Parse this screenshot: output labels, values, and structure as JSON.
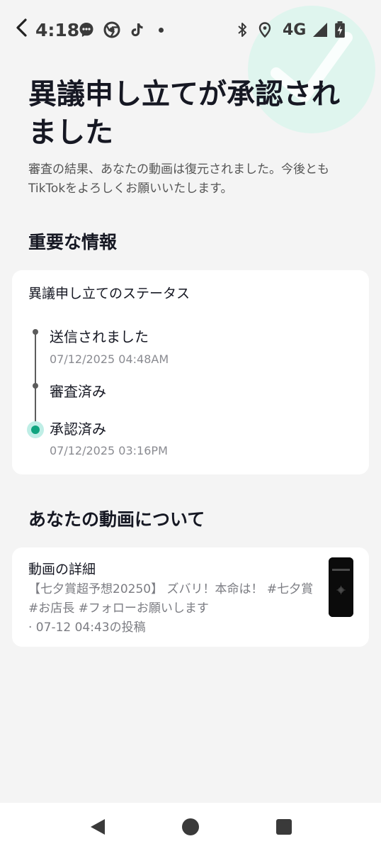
{
  "status_bar": {
    "time": "4:18",
    "network": "4G",
    "icons": [
      "messenger-icon",
      "chrome-icon",
      "tiktok-icon",
      "notification-dot",
      "bluetooth-icon",
      "location-icon",
      "signal-icon",
      "battery-icon"
    ]
  },
  "header": {
    "title": "異議申し立てが承認されました",
    "subtitle": "審査の結果、あなたの動画は復元されました。今後ともTikTokをよろしくお願いいたします。"
  },
  "important_info": {
    "heading": "重要な情報",
    "status_card": {
      "title": "異議申し立てのステータス",
      "steps": [
        {
          "label": "送信されました",
          "time": "07/12/2025 04:48AM",
          "active": false
        },
        {
          "label": "審査済み",
          "time": "",
          "active": false
        },
        {
          "label": "承認済み",
          "time": "07/12/2025 03:16PM",
          "active": true
        }
      ]
    }
  },
  "about_video": {
    "heading": "あなたの動画について",
    "card": {
      "title": "動画の詳細",
      "description": "【七夕賞超予想20250】 ズバリ！本命は！ #七夕賞 #お店長 #フォローお願いします",
      "posted": "· 07-12 04:43の投稿"
    }
  },
  "colors": {
    "accent": "#0fa47f",
    "accent_light": "#bfeee6",
    "background": "#f4f4f4",
    "card": "#ffffff",
    "text_primary": "#161823",
    "text_secondary": "#8a8b91"
  }
}
